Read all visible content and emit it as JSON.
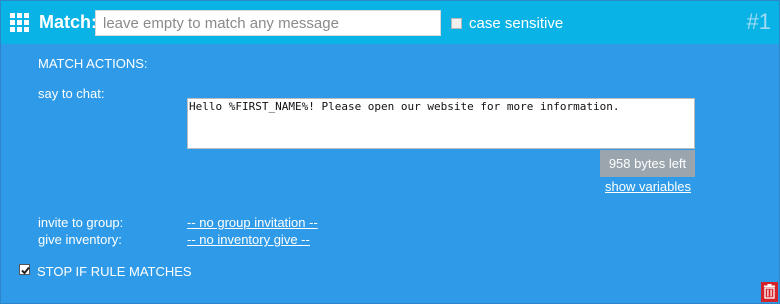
{
  "header": {
    "match_label": "Match:",
    "match_placeholder": "leave empty to match any message",
    "match_value": "",
    "case_sensitive_label": "case sensitive",
    "rule_number": "#1"
  },
  "actions": {
    "section_title": "MATCH ACTIONS:",
    "say_label": "say to chat:",
    "say_value": "Hello %FIRST_NAME%! Please open our website for more information.",
    "bytes_left": "958 bytes left",
    "show_variables": "show variables",
    "invite_label": "invite to group:",
    "invite_value": "-- no group invitation --",
    "give_label": "give inventory:",
    "give_value": "-- no inventory give --",
    "stop_label": "STOP IF RULE MATCHES",
    "stop_checked": true,
    "case_sensitive_checked": false
  },
  "colors": {
    "panel": "#2f9be8",
    "header": "#09b3e6",
    "trash": "#d4242a"
  },
  "icons": {
    "menu": "grid-icon",
    "delete": "trash-icon",
    "stop_check": "checkmark-icon"
  }
}
